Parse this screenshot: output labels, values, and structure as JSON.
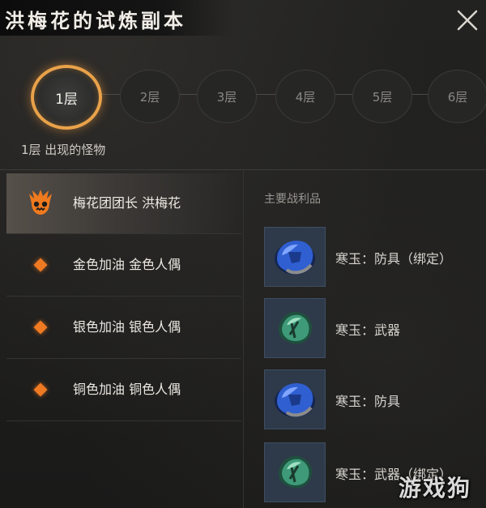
{
  "header": {
    "title": "洪梅花的试炼副本"
  },
  "floors": {
    "items": [
      "1层",
      "2层",
      "3层",
      "4层",
      "5层",
      "6层"
    ],
    "active_index": 0,
    "caption": "1层 出现的怪物"
  },
  "monsters": [
    {
      "name": "梅花团团长 洪梅花",
      "icon": "boss-skull-icon",
      "selected": true
    },
    {
      "name": "金色加油 金色人偶",
      "icon": "diamond-icon",
      "selected": false
    },
    {
      "name": "银色加油 银色人偶",
      "icon": "diamond-icon",
      "selected": false
    },
    {
      "name": "铜色加油 铜色人偶",
      "icon": "diamond-icon",
      "selected": false
    }
  ],
  "loot": {
    "heading": "主要战利品",
    "items": [
      {
        "name": "寒玉：防具（绑定）",
        "gem": "blue"
      },
      {
        "name": "寒玉：武器",
        "gem": "green"
      },
      {
        "name": "寒玉：防具",
        "gem": "blue"
      },
      {
        "name": "寒玉：武器（绑定）",
        "gem": "green"
      }
    ]
  },
  "watermark": "游戏狗",
  "colors": {
    "accent": "#e9a24a",
    "marker": "#ef7a22",
    "gem_blue": "#2f5fd0",
    "gem_green": "#3e9a78"
  }
}
